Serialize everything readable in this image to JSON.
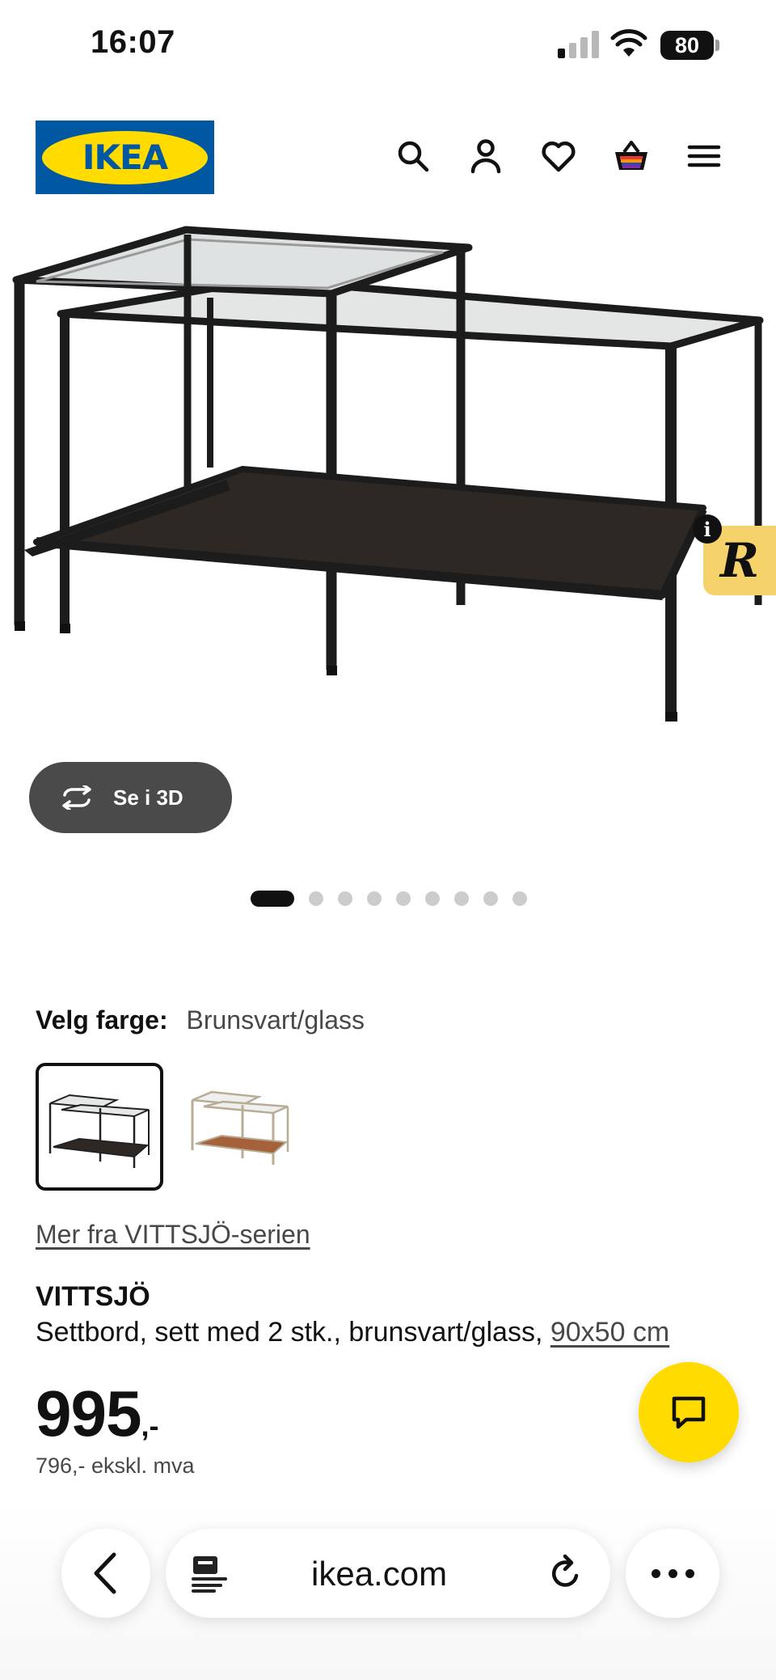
{
  "status_bar": {
    "time": "16:07",
    "battery": "80"
  },
  "header": {
    "logo_text": "IKEA",
    "icons": [
      "search-icon",
      "account-icon",
      "heart-icon",
      "cart-icon",
      "menu-icon"
    ]
  },
  "gallery": {
    "view_3d_label": "Se i 3D",
    "image_count": 9,
    "current_image": 1,
    "badge_letter": "R",
    "badge_info": "i"
  },
  "product": {
    "color_label": "Velg farge:",
    "color_value": "Brunsvart/glass",
    "swatches": [
      "brunsvart/glass",
      "beige/glass"
    ],
    "selected_swatch": 0,
    "series_link": "Mer fra VITTSJÖ-serien",
    "name": "VITTSJÖ",
    "description": "Settbord, sett med 2 stk., brunsvart/glass,",
    "size": "90x50 cm",
    "price": "995",
    "price_suffix": ",-",
    "price_ex_vat": "796,- ekskl. mva"
  },
  "browser": {
    "url": "ikea.com"
  },
  "colors": {
    "ikea_blue": "#0058a3",
    "ikea_yellow": "#ffdb00",
    "button_dark": "#4a4a4a"
  }
}
